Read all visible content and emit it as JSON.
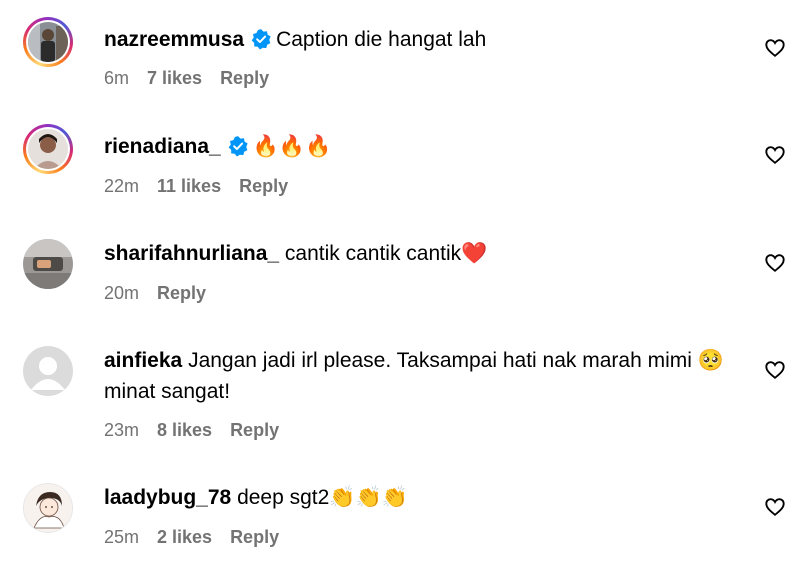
{
  "comments": [
    {
      "username": "nazreemmusa",
      "verified": true,
      "text": "Caption die hangat lah",
      "time": "6m",
      "likes": "7 likes",
      "reply": "Reply"
    },
    {
      "username": "rienadiana_",
      "verified": true,
      "text": "🔥🔥🔥",
      "time": "22m",
      "likes": "11 likes",
      "reply": "Reply"
    },
    {
      "username": "sharifahnurliana_",
      "verified": false,
      "text": "cantik cantik cantik❤️",
      "time": "20m",
      "reply": "Reply"
    },
    {
      "username": "ainfieka",
      "verified": false,
      "text": "Jangan jadi irl please. Taksampai hati nak marah mimi 🥺 minat sangat!",
      "time": "23m",
      "likes": "8 likes",
      "reply": "Reply"
    },
    {
      "username": "laadybug_78",
      "verified": false,
      "text": "deep sgt2👏👏👏",
      "time": "25m",
      "likes": "2 likes",
      "reply": "Reply"
    }
  ],
  "colors": {
    "verified": "#0095f6",
    "meta": "#737373"
  }
}
